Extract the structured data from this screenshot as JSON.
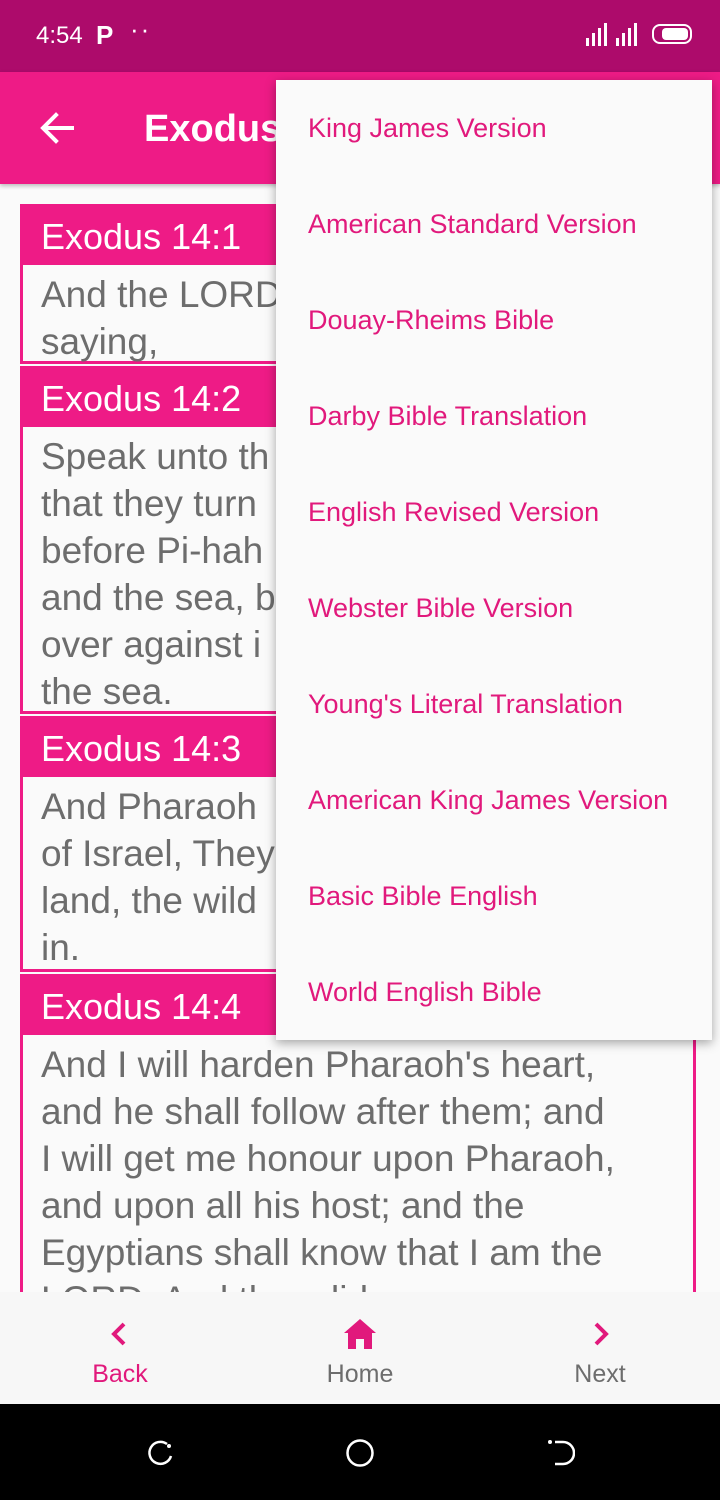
{
  "status_bar": {
    "time": "4:54",
    "notification_icons": [
      "p-icon",
      "more-dots-icon"
    ],
    "system_icons": [
      "signal-icon",
      "battery-icon"
    ]
  },
  "app_bar": {
    "title": "Exodus",
    "back_icon": "arrow-left-icon"
  },
  "verses": [
    {
      "ref": "Exodus 14:1",
      "text": "And the LORD\nsaying,"
    },
    {
      "ref": "Exodus 14:2",
      "text": "Speak unto th\nthat they turn\nbefore Pi-hah\nand the sea, b\nover against i\nthe sea."
    },
    {
      "ref": "Exodus 14:3",
      "text": "And Pharaoh\nof Israel, They\nland, the wild\nin."
    },
    {
      "ref": "Exodus 14:4",
      "text": "And I will harden Pharaoh's heart,\nand he shall follow after them; and\nI will get me honour upon Pharaoh,\nand upon all his host; and the\nEgyptians shall know that I am the\nLORD. And they did so."
    }
  ],
  "version_menu": {
    "items": [
      "King James Version",
      "American Standard Version",
      "Douay-Rheims Bible",
      "Darby Bible Translation",
      "English Revised Version",
      "Webster Bible Version",
      "Young's Literal Translation",
      "American King James Version",
      "Basic Bible English",
      "World English Bible"
    ]
  },
  "bottom_nav": {
    "back": {
      "label": "Back",
      "icon": "chevron-left-icon",
      "color": "#e1197c"
    },
    "home": {
      "label": "Home",
      "icon": "home-icon",
      "color": "#6d6d6d"
    },
    "next": {
      "label": "Next",
      "icon": "chevron-right-icon",
      "color": "#6d6d6d"
    }
  },
  "colors": {
    "status_bar": "#ad0b6b",
    "app_bar": "#ee1b86",
    "accent": "#e1197c",
    "body_text": "#6d6d6d"
  }
}
